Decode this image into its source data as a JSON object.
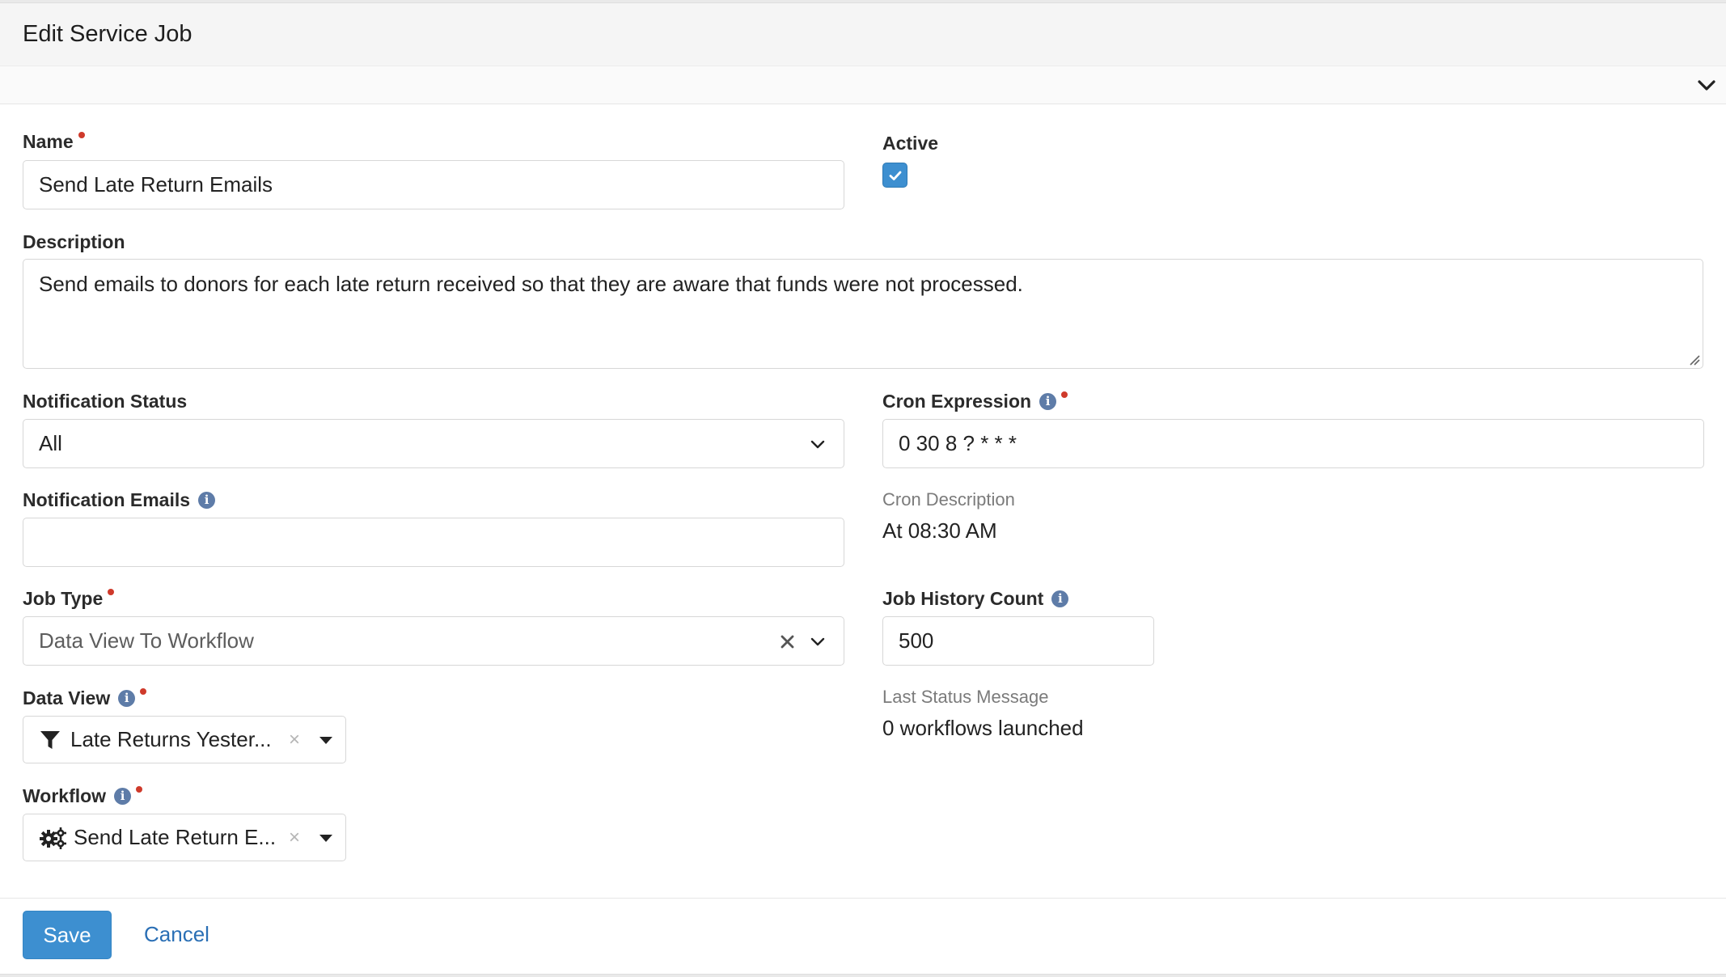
{
  "panel": {
    "title": "Edit Service Job"
  },
  "fields": {
    "name": {
      "label": "Name",
      "value": "Send Late Return Emails"
    },
    "active": {
      "label": "Active",
      "checked": true
    },
    "description": {
      "label": "Description",
      "value": "Send emails to donors for each late return received so that they are aware that funds were not processed."
    },
    "notification_status": {
      "label": "Notification Status",
      "value": "All"
    },
    "cron_expression": {
      "label": "Cron Expression",
      "value": "0 30 8 ? * * *"
    },
    "notification_emails": {
      "label": "Notification Emails",
      "value": ""
    },
    "cron_description": {
      "label": "Cron Description",
      "value": "At 08:30 AM"
    },
    "job_type": {
      "label": "Job Type",
      "value": "Data View To Workflow"
    },
    "job_history_count": {
      "label": "Job History Count",
      "value": "500"
    },
    "data_view": {
      "label": "Data View",
      "value": "Late Returns Yester..."
    },
    "last_status_message": {
      "label": "Last Status Message",
      "value": "0 workflows launched"
    },
    "workflow": {
      "label": "Workflow",
      "value": "Send Late Return E..."
    }
  },
  "actions": {
    "save_label": "Save",
    "cancel_label": "Cancel"
  },
  "icons": {
    "info": "info-icon",
    "required": "required-dot",
    "filter": "filter-icon",
    "gears": "gears-icon",
    "chevron": "chevron-down-icon",
    "clear": "close-icon",
    "check": "check-icon"
  },
  "colors": {
    "accent": "#3d8fd0",
    "required": "#cf3a2b",
    "info": "#5e7ca8",
    "link": "#2a6fb5"
  },
  "info_glyph": "i",
  "clear_glyph": "×"
}
